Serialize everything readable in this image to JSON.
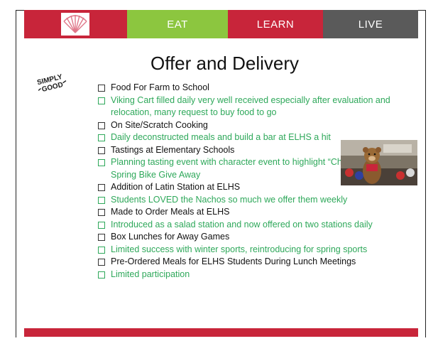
{
  "nav": {
    "eat": "EAT",
    "learn": "LEARN",
    "live": "LIVE"
  },
  "title": "Offer and Delivery",
  "logo": {
    "line1": "SIMPLY",
    "line2": "GOOD"
  },
  "items": [
    {
      "type": "main",
      "text": "Food For Farm to School"
    },
    {
      "type": "sub",
      "text": "Viking Cart filled daily very well received especially after evaluation and relocation, many request to buy food to go"
    },
    {
      "type": "main",
      "text": "On Site/Scratch Cooking"
    },
    {
      "type": "sub",
      "text": "Daily deconstructed meals and build a bar at ELHS a hit"
    },
    {
      "type": "main",
      "text": "Tastings at Elementary Schools"
    },
    {
      "type": "sub",
      "text": "Planning tasting event with character event to highlight “Chartwhells” Spring Bike Give Away"
    },
    {
      "type": "main",
      "text": "Addition of Latin Station at ELHS"
    },
    {
      "type": "sub",
      "text": "Students LOVED the Nachos so much we offer them weekly"
    },
    {
      "type": "main",
      "text": "Made to Order Meals at ELHS"
    },
    {
      "type": "sub",
      "text": "Introduced  as a salad station and now offered on two stations daily"
    },
    {
      "type": "main",
      "text": "Box Lunches for Away Games"
    },
    {
      "type": "sub",
      "text": "Limited success with winter sports, reintroducing for spring sports"
    },
    {
      "type": "main",
      "text": "Pre-Ordered Meals for ELHS Students During Lunch Meetings"
    },
    {
      "type": "sub",
      "text": "Limited participation"
    }
  ],
  "colors": {
    "red": "#c8253a",
    "green": "#8cc63f",
    "gray": "#5a5a5a",
    "text_green": "#2ea85a"
  }
}
